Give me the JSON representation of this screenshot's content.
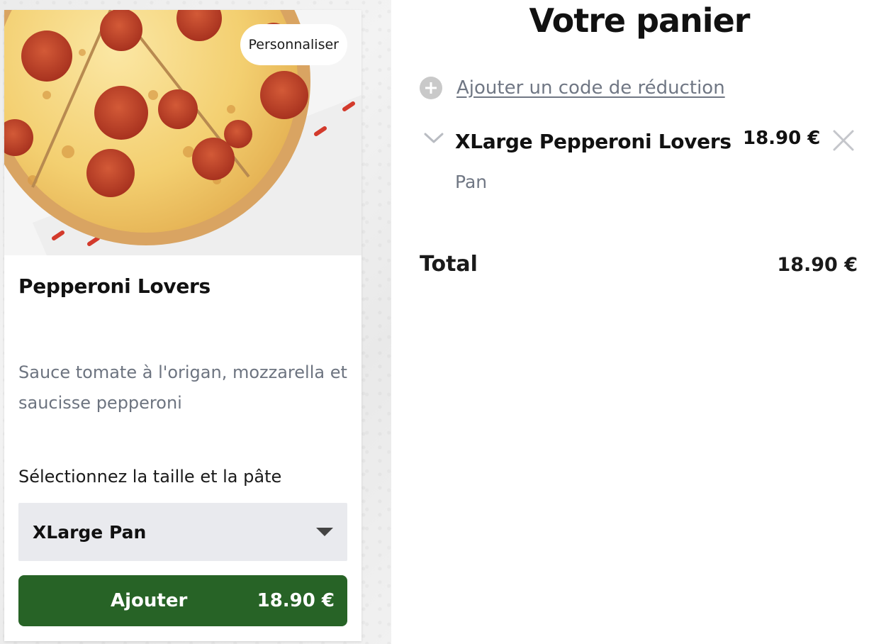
{
  "product": {
    "image_alt": "Pepperoni pizza",
    "customize_label": "Personnaliser",
    "name": "Pepperoni Lovers",
    "description": "Sauce tomate à l'origan, mozzarella et saucisse pepperoni",
    "select_label": "Sélectionnez la taille et la pâte",
    "selected_option": "XLarge Pan",
    "add_button_label": "Ajouter",
    "add_button_price": "18.90 €"
  },
  "cart": {
    "title": "Votre panier",
    "promo_label": "Ajouter un code de réduction",
    "items": [
      {
        "name": "XLarge Pepperoni Lovers",
        "price": "18.90 €",
        "detail": "Pan"
      }
    ],
    "total_label": "Total",
    "total_value": "18.90 €"
  },
  "colors": {
    "add_button_bg": "#276326",
    "muted_text": "#707784",
    "select_bg": "#e9eaee"
  },
  "icons": {
    "promo": "plus-circle-icon",
    "expand": "chevron-down-icon",
    "remove": "close-icon",
    "dropdown": "caret-down-icon"
  }
}
